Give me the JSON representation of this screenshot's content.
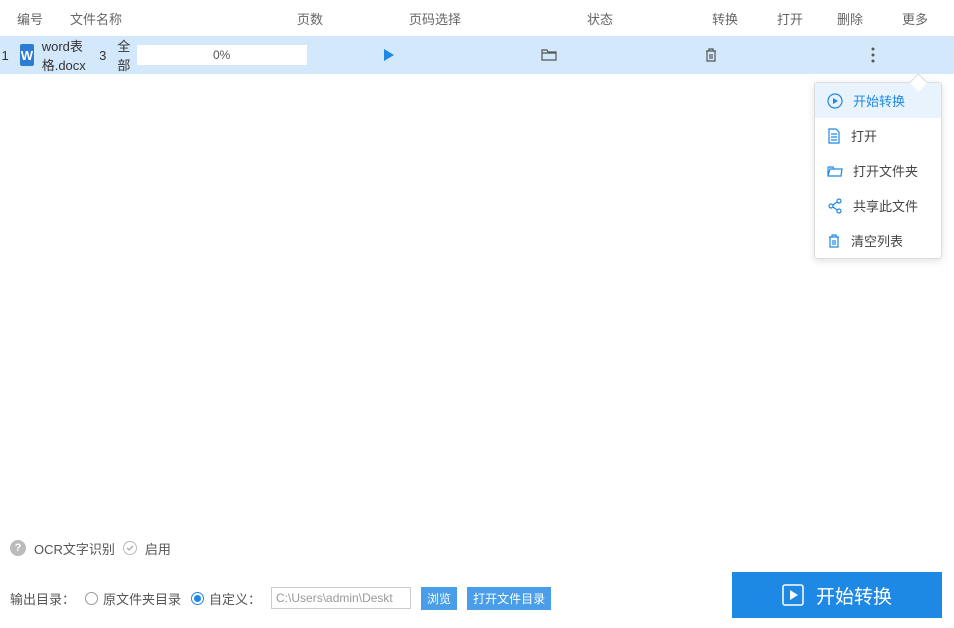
{
  "headers": {
    "index": "编号",
    "name": "文件名称",
    "pages": "页数",
    "pagesel": "页码选择",
    "status": "状态",
    "convert": "转换",
    "open": "打开",
    "delete": "删除",
    "more": "更多"
  },
  "row": {
    "index": "1",
    "icon_letter": "W",
    "filename": "word表格.docx",
    "pages": "3",
    "pagesel": "全部",
    "progress": "0%"
  },
  "menu": {
    "items": [
      {
        "label": "开始转换"
      },
      {
        "label": "打开"
      },
      {
        "label": "打开文件夹"
      },
      {
        "label": "共享此文件"
      },
      {
        "label": "清空列表"
      }
    ]
  },
  "ocr": {
    "label": "OCR文字识别",
    "enable": "启用"
  },
  "output": {
    "label": "输出目录：",
    "opt1": "原文件夹目录",
    "opt2": "自定义：",
    "path": "C:\\Users\\admin\\Deskt",
    "browse": "浏览",
    "open_dir": "打开文件目录"
  },
  "start_btn": "开始转换"
}
